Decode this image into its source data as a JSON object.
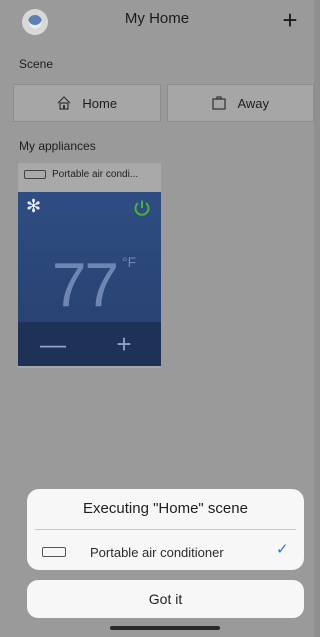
{
  "header": {
    "title": "My Home",
    "add_label": "+"
  },
  "scene": {
    "label": "Scene",
    "buttons": [
      {
        "label": "Home",
        "icon": "home-icon"
      },
      {
        "label": "Away",
        "icon": "suitcase-icon"
      }
    ]
  },
  "appliances": {
    "label": "My appliances",
    "card": {
      "name": "Portable air condi...",
      "temperature": "77",
      "unit": "°F",
      "mode_icon": "snowflake-icon",
      "power_icon": "power-icon",
      "minus": "—",
      "plus": "+"
    }
  },
  "dialog": {
    "title": "Executing \"Home\" scene",
    "item": "Portable air conditioner",
    "confirm": "Got it"
  },
  "colors": {
    "accent_blue": "#2f77d1",
    "power_green": "#46b43a",
    "panel_blue": "#2f4d83"
  }
}
